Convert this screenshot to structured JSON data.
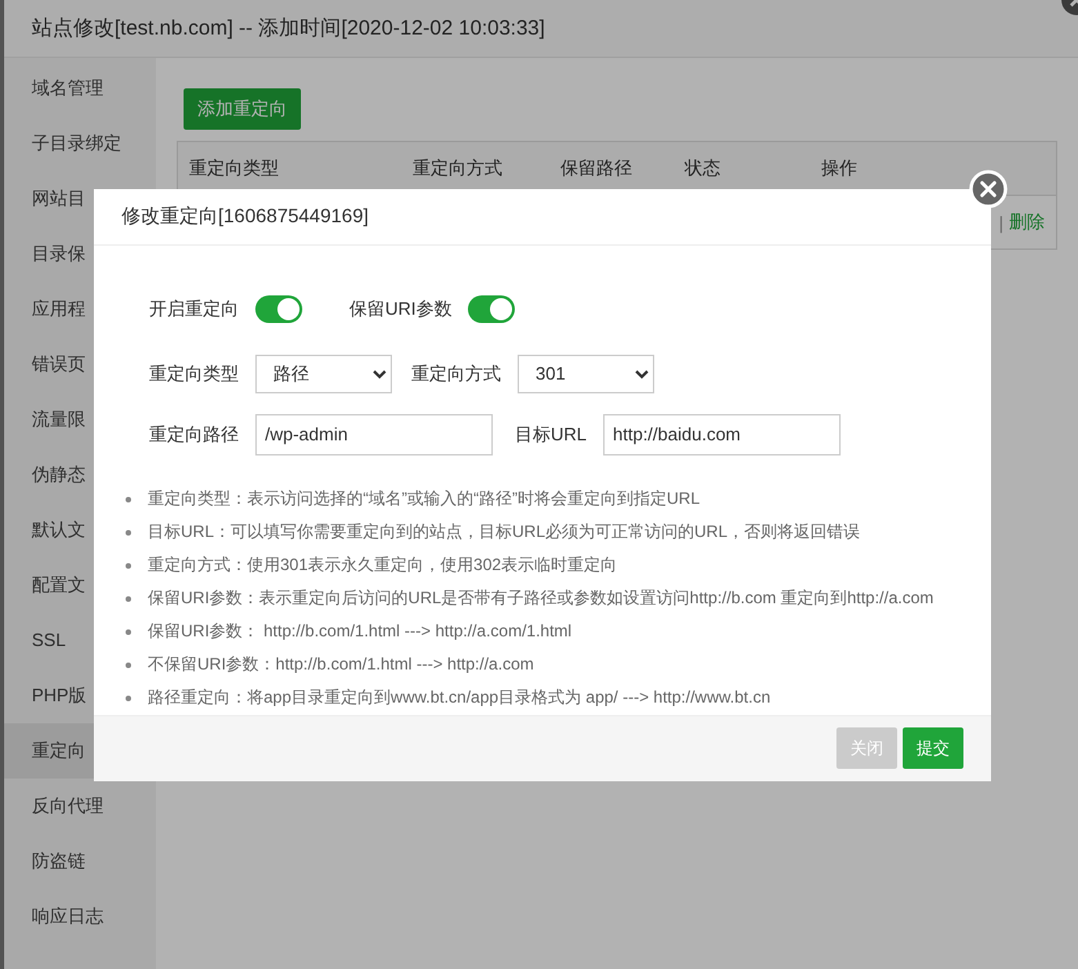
{
  "window": {
    "title": "站点修改[test.nb.com] -- 添加时间[2020-12-02 10:03:33]"
  },
  "sidebar": {
    "items": [
      {
        "label": "域名管理",
        "selected": false
      },
      {
        "label": "子目录绑定",
        "selected": false
      },
      {
        "label": "网站目",
        "selected": false
      },
      {
        "label": "目录保",
        "selected": false
      },
      {
        "label": "应用程",
        "selected": false
      },
      {
        "label": "错误页",
        "selected": false
      },
      {
        "label": "流量限",
        "selected": false
      },
      {
        "label": "伪静态",
        "selected": false
      },
      {
        "label": "默认文",
        "selected": false
      },
      {
        "label": "配置文",
        "selected": false
      },
      {
        "label": "SSL",
        "selected": false
      },
      {
        "label": "PHP版",
        "selected": false
      },
      {
        "label": "重定向",
        "selected": true
      },
      {
        "label": "反向代理",
        "selected": false
      },
      {
        "label": "防盗链",
        "selected": false
      },
      {
        "label": "响应日志",
        "selected": false
      }
    ]
  },
  "content": {
    "add_button": "添加重定向",
    "table": {
      "columns": [
        "重定向类型",
        "重定向方式",
        "保留路径",
        "状态",
        "操作"
      ],
      "rows": [
        {
          "separator": "|",
          "action": "删除"
        }
      ]
    }
  },
  "dialog": {
    "title": "修改重定向[1606875449169]",
    "toggles": [
      {
        "label": "开启重定向",
        "on": true
      },
      {
        "label": "保留URI参数",
        "on": true
      }
    ],
    "selects": [
      {
        "label": "重定向类型",
        "value": "路径"
      },
      {
        "label": "重定向方式",
        "value": "301"
      }
    ],
    "inputs": [
      {
        "label": "重定向路径",
        "value": "/wp-admin"
      },
      {
        "label": "目标URL",
        "value": "http://baidu.com"
      }
    ],
    "notes": [
      "重定向类型：表示访问选择的“域名”或输入的“路径”时将会重定向到指定URL",
      "目标URL：可以填写你需要重定向到的站点，目标URL必须为可正常访问的URL，否则将返回错误",
      "重定向方式：使用301表示永久重定向，使用302表示临时重定向",
      "保留URI参数：表示重定向后访问的URL是否带有子路径或参数如设置访问http://b.com 重定向到http://a.com",
      "保留URI参数： http://b.com/1.html ---> http://a.com/1.html",
      "不保留URI参数：http://b.com/1.html ---> http://a.com",
      "路径重定向：将app目录重定向到www.bt.cn/app目录格式为 app/ ---> http://www.bt.cn"
    ],
    "buttons": [
      {
        "label": "关闭",
        "kind": "cancel"
      },
      {
        "label": "提交",
        "kind": "primary"
      }
    ]
  }
}
